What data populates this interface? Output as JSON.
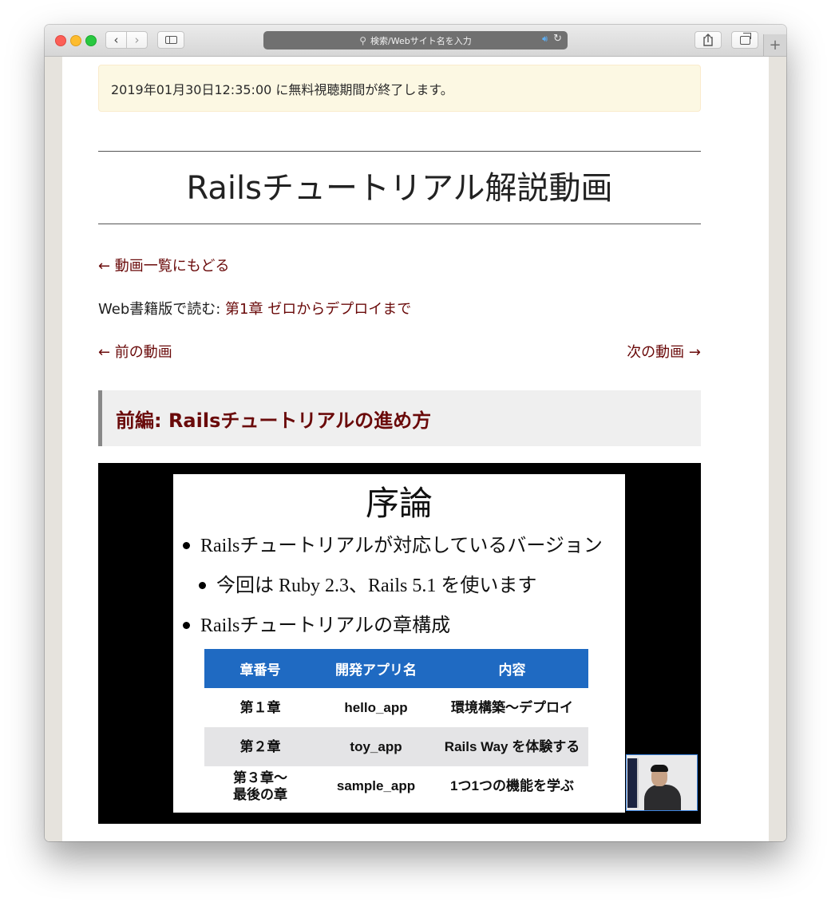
{
  "browser": {
    "address_placeholder": "検索/Webサイト名を入力",
    "new_tab_symbol": "+",
    "icons": [
      "close-dot",
      "minimize-dot",
      "zoom-dot",
      "chevron-left-icon",
      "chevron-right-icon",
      "sidebar-icon",
      "search-icon",
      "speaker-icon",
      "reload-icon",
      "share-icon",
      "tabs-icon",
      "plus-icon"
    ]
  },
  "notice": {
    "text": "2019年01月30日12:35:00 に無料視聴期間が終了します。"
  },
  "page": {
    "title": "Railsチュートリアル解説動画",
    "back_link": "← 動画一覧にもどる",
    "web_book_prefix": "Web書籍版で読む: ",
    "web_book_link": "第1章 ゼロからデプロイまで",
    "prev_video": "← 前の動画",
    "next_video": "次の動画 →",
    "section_title": "前編: Railsチュートリアルの進め方"
  },
  "video": {
    "slide": {
      "title": "序論",
      "bullet1": "Railsチュートリアルが対応しているバージョン",
      "bullet2": "今回は Ruby 2.3、Rails 5.1 を使います",
      "bullet3": "Railsチュートリアルの章構成",
      "table": {
        "headers": [
          "章番号",
          "開発アプリ名",
          "内容"
        ],
        "rows": [
          [
            "第１章",
            "hello_app",
            "環境構築〜デプロイ"
          ],
          [
            "第２章",
            "toy_app",
            "Rails Way を体験する"
          ],
          [
            "第３章〜\n最後の章",
            "sample_app",
            "1つ1つの機能を学ぶ"
          ]
        ]
      }
    }
  },
  "colors": {
    "link": "#6a0a0a",
    "notice_bg": "#fcf8e3",
    "table_header": "#1f6ac2",
    "section_bg": "#efefef"
  }
}
